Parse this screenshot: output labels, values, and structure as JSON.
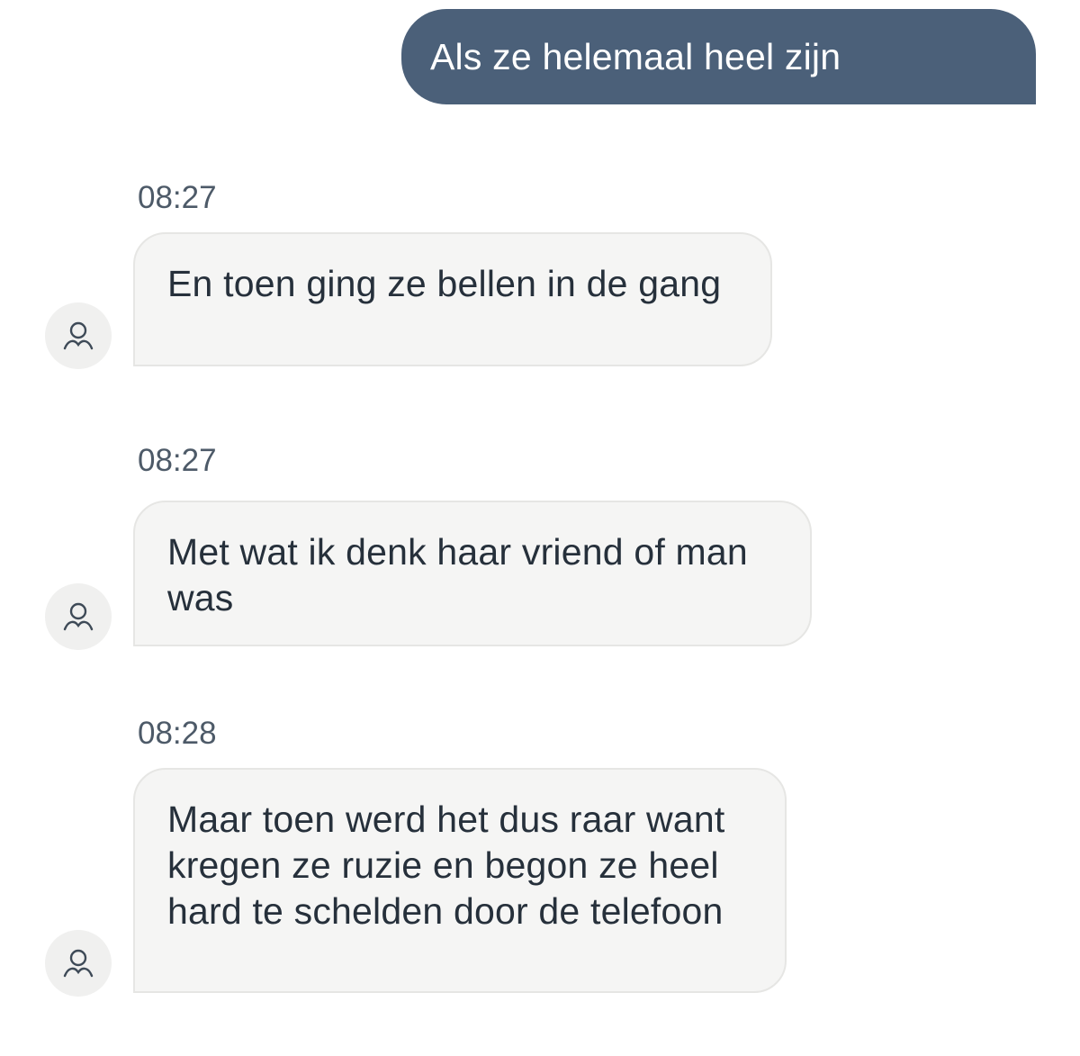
{
  "messages": {
    "sent": [
      {
        "text": "Als ze helemaal heel zijn"
      }
    ],
    "received": [
      {
        "time": "08:27",
        "text": "En toen ging ze bellen in de gang",
        "avatar_icon": "user-icon"
      },
      {
        "time": "08:27",
        "text": "Met wat ik denk haar vriend of man was",
        "avatar_icon": "user-icon"
      },
      {
        "time": "08:28",
        "text": "Maar toen werd het dus raar want kregen ze ruzie en begon ze heel hard te schelden door de telefoon",
        "avatar_icon": "user-icon"
      }
    ]
  },
  "colors": {
    "sent_bubble": "#4b6079",
    "received_bubble": "#f5f5f4",
    "timestamp": "#4d5a68"
  }
}
